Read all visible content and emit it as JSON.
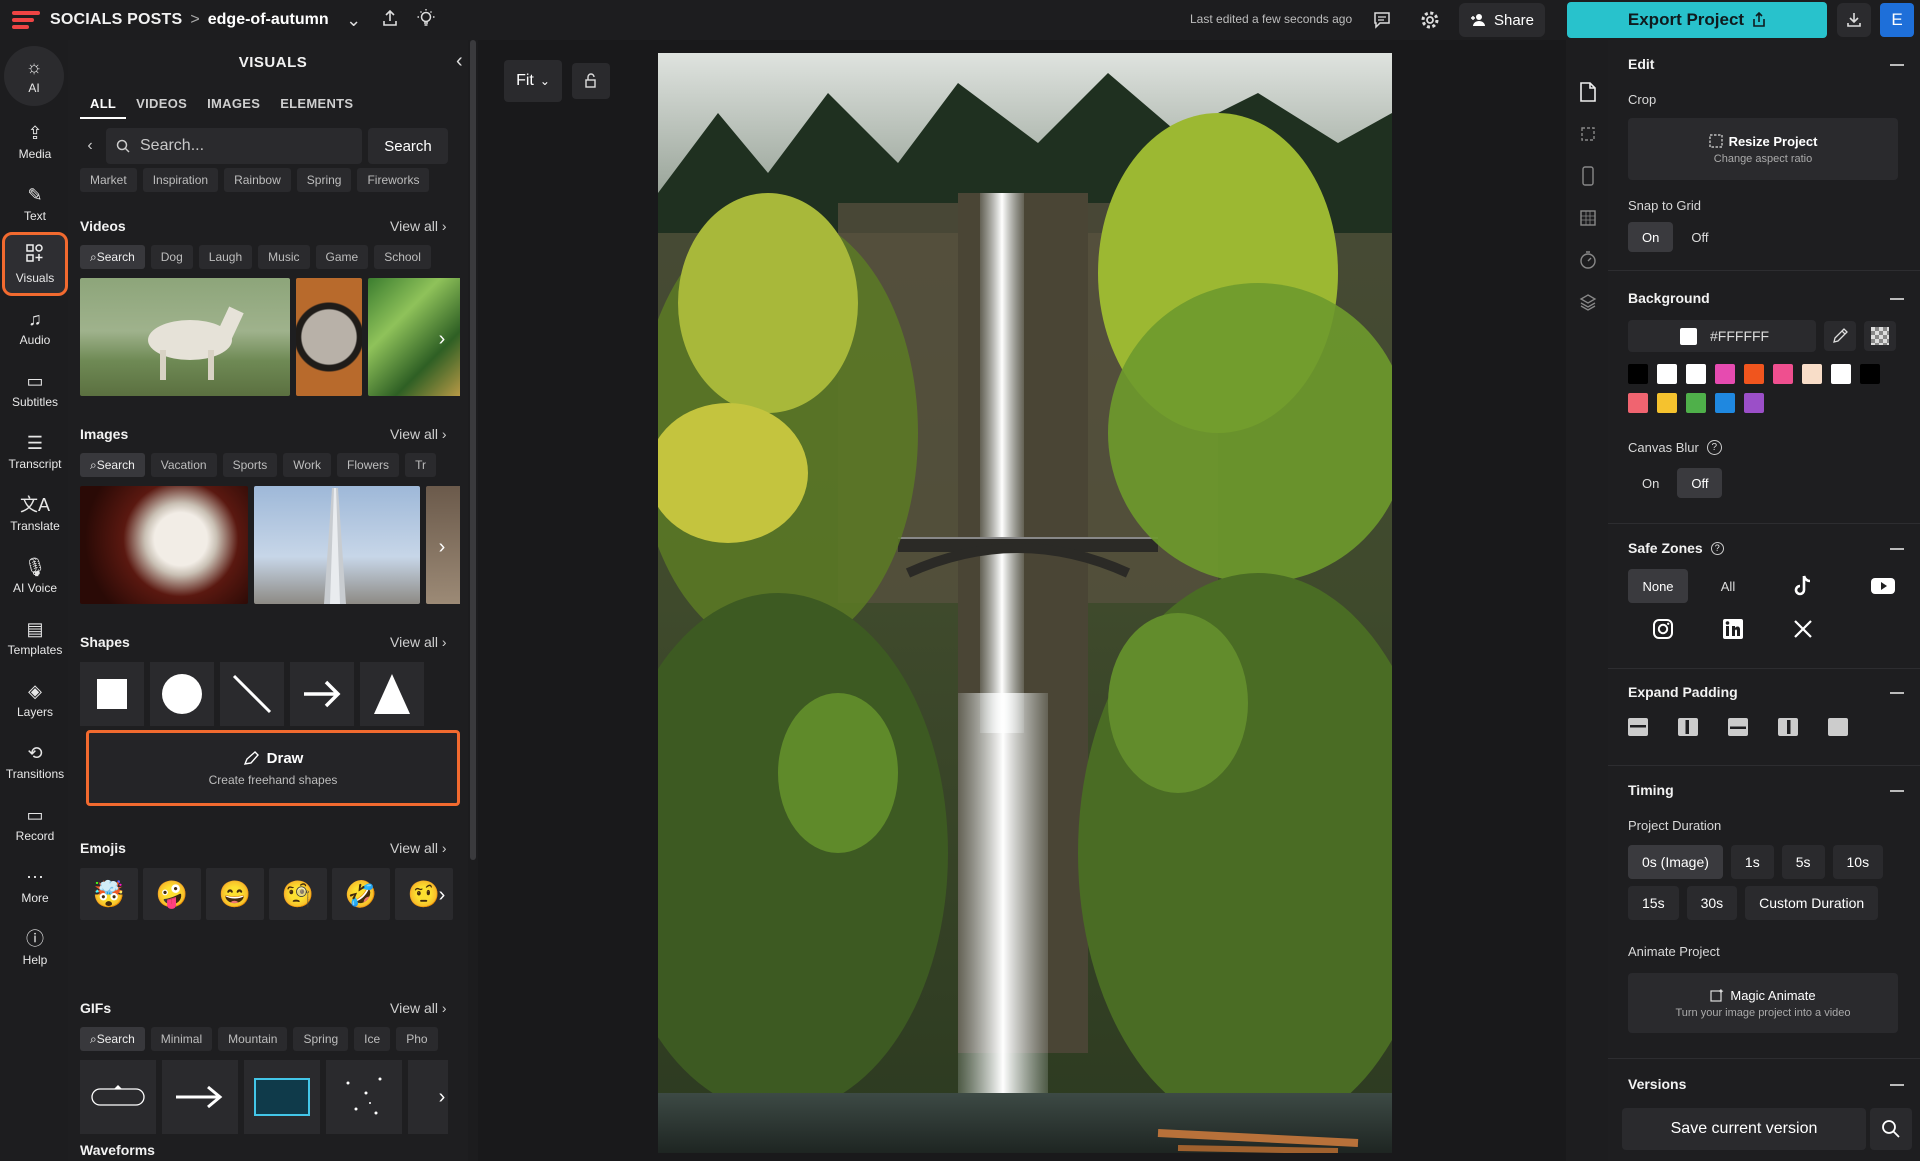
{
  "topbar": {
    "breadcrumb_root": "SOCIALS POSTS",
    "breadcrumb_sep": ">",
    "project_name": "edge-of-autumn",
    "last_edited": "Last edited a few seconds ago",
    "share_label": "Share",
    "export_label": "Export Project",
    "avatar_letter": "E"
  },
  "leftnav": [
    {
      "label": "AI",
      "icon": "lightbulb-icon"
    },
    {
      "label": "Media",
      "icon": "upload-icon"
    },
    {
      "label": "Text",
      "icon": "text-edit-icon"
    },
    {
      "label": "Visuals",
      "icon": "visuals-icon",
      "active": true
    },
    {
      "label": "Audio",
      "icon": "music-note-icon"
    },
    {
      "label": "Subtitles",
      "icon": "subtitles-icon"
    },
    {
      "label": "Transcript",
      "icon": "transcript-icon"
    },
    {
      "label": "Translate",
      "icon": "translate-icon"
    },
    {
      "label": "AI Voice",
      "icon": "microphone-icon"
    },
    {
      "label": "Templates",
      "icon": "templates-icon"
    },
    {
      "label": "Layers",
      "icon": "layers-icon"
    },
    {
      "label": "Transitions",
      "icon": "transitions-icon"
    },
    {
      "label": "Record",
      "icon": "record-icon"
    },
    {
      "label": "More",
      "icon": "more-dots-icon"
    },
    {
      "label": "Help",
      "icon": "help-icon"
    }
  ],
  "visuals": {
    "title": "VISUALS",
    "tabs": [
      "ALL",
      "VIDEOS",
      "IMAGES",
      "ELEMENTS"
    ],
    "search_placeholder": "Search...",
    "search_button": "Search",
    "top_chips": [
      "Market",
      "Inspiration",
      "Rainbow",
      "Spring",
      "Fireworks"
    ],
    "view_all": "View all",
    "videos": {
      "title": "Videos",
      "chips": [
        "Search",
        "Dog",
        "Laugh",
        "Music",
        "Game",
        "School"
      ]
    },
    "images": {
      "title": "Images",
      "chips": [
        "Search",
        "Vacation",
        "Sports",
        "Work",
        "Flowers",
        "Tr"
      ]
    },
    "shapes": {
      "title": "Shapes"
    },
    "draw": {
      "title": "Draw",
      "subtitle": "Create freehand shapes"
    },
    "emojis": {
      "title": "Emojis",
      "items": [
        "🤯",
        "🤪",
        "😄",
        "🧐",
        "🤣",
        "🤨"
      ]
    },
    "gifs": {
      "title": "GIFs",
      "chips": [
        "Search",
        "Minimal",
        "Mountain",
        "Spring",
        "Ice",
        "Pho"
      ]
    },
    "waveforms": {
      "title": "Waveforms"
    }
  },
  "canvas": {
    "fit_label": "Fit"
  },
  "right_panel": {
    "edit": {
      "title": "Edit",
      "crop_label": "Crop",
      "resize_title": "Resize Project",
      "resize_sub": "Change aspect ratio",
      "snap_label": "Snap to Grid",
      "on": "On",
      "off": "Off",
      "snap_value": "On"
    },
    "background": {
      "title": "Background",
      "color": "#FFFFFF",
      "canvas_blur_label": "Canvas Blur",
      "blur_value": "Off",
      "swatches": [
        "#000000",
        "#ffffff",
        "#ffffff",
        "#e64bb0",
        "#f0551e",
        "#ef4f8f",
        "#f8ddc8",
        "#ffffff",
        "#000000",
        "#f06470",
        "#f5c22e",
        "#4fb04a",
        "#1f88e0",
        "#9b4fc8"
      ]
    },
    "safe_zones": {
      "title": "Safe Zones",
      "none": "None",
      "all": "All"
    },
    "expand_padding": {
      "title": "Expand Padding"
    },
    "timing": {
      "title": "Timing",
      "duration_label": "Project Duration",
      "durations_row1": [
        "0s (Image)",
        "1s",
        "5s",
        "10s"
      ],
      "durations_row2": [
        "15s",
        "30s",
        "Custom Duration"
      ],
      "animate_label": "Animate Project",
      "magic_title": "Magic Animate",
      "magic_sub": "Turn your image project into a video"
    },
    "versions": {
      "title": "Versions",
      "save_label": "Save current version"
    }
  }
}
